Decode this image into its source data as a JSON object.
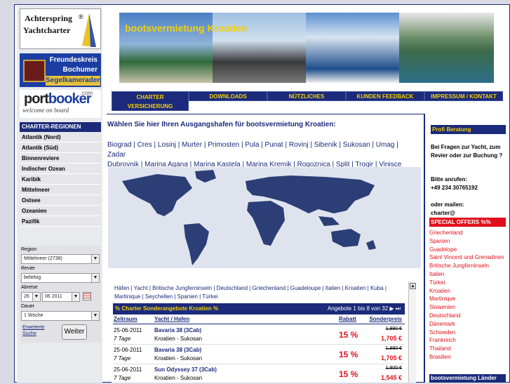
{
  "logos": {
    "achterspring": {
      "line1": "Achterspring",
      "line2": "Yachtcharter",
      "reg": "®"
    },
    "freundeskreis": {
      "line1": "Freundeskreis",
      "line2": "Bochumer",
      "line3": "Segelkameraden"
    },
    "portbooker": {
      "brand_a": "port",
      "brand_b": "booker",
      "domain": ".com",
      "slogan": "welcome on board"
    }
  },
  "regions": {
    "header": "CHARTER-REGIONEN",
    "items": [
      "Atlantik (Nord)",
      "Atlantik (Süd)",
      "Binnenreviere",
      "Indischer Ozean",
      "Karibik",
      "Mittelmeer",
      "Ostsee",
      "Ozeanien",
      "Pazifik"
    ]
  },
  "search": {
    "region_label": "Region",
    "region_value": "Mittelmeer (2738)",
    "revier_label": "Revier",
    "revier_value": "beliebig",
    "abreise_label": "Abreise",
    "day_value": "26",
    "month_value": "06 2011",
    "dauer_label": "Dauer",
    "dauer_value": "1 Woche",
    "extended_1": "Erweiterte",
    "extended_2": "Suche",
    "submit": "Weiter"
  },
  "banner": {
    "title": "bootsvermietung Kroatien"
  },
  "nav": {
    "charter_1": "CHARTER",
    "charter_2": "VERSICHERUNG",
    "downloads": "DOWNLOADS",
    "nuetzliches": "NÜTZLICHES",
    "feedback": "KUNDEN FEEDBACK",
    "impressum": "IMPRESSUM / KONTAKT"
  },
  "main": {
    "heading": "Wählen Sie hier Ihren Ausgangshafen für bootsvermietung Kroatien:",
    "harbors_line1": "Biograd | Cres | Losinj | Murter | Primosten | Pula | Punat | Rovinj | Sibenik | Sukosan | Umag | Zadar",
    "harbors_line2": "Dubrovnik | Marina Agana | Marina Kastela | Marina Kremik | Rogoznica | Split | Trogir | Vinisce"
  },
  "offers": {
    "crumbs_line1": "Häfen | Yacht | Britische Jungferninseln | Deutschland | Griechenland | Guadeloupe | Italien | Kroatien | Kuba |",
    "crumbs_line2": "Martinique | Seychellen | Spanien | Türkei",
    "header": "% Charter Sonderangebote Kroatien %",
    "count": "Angebote 1 bis 8 von 32",
    "col_date": "Zeitraum",
    "col_yacht": "Yacht / Hafen",
    "col_discount": "Rabatt",
    "col_price": "Sonderpreis",
    "rows": [
      {
        "date": "25-06-2011",
        "nights": "7 Tage",
        "yacht": "Bavaria 38 (3Cab)",
        "harbor": "Kroatien - Sukosan",
        "discount": "15 %",
        "old": "1,990 €",
        "new": "1,705 €"
      },
      {
        "date": "25-06-2011",
        "nights": "7 Tage",
        "yacht": "Bavaria 38 (3Cab)",
        "harbor": "Kroatien - Sukosan",
        "discount": "15 %",
        "old": "1,990 €",
        "new": "1,705 €"
      },
      {
        "date": "25-06-2011",
        "nights": "7 Tage",
        "yacht": "Sun Odyssey 37 (3Cab)",
        "harbor": "Kroatien - Sukosan",
        "discount": "15 %",
        "old": "1,800 €",
        "new": "1,545 €"
      }
    ]
  },
  "right": {
    "header": "Profi Beratung",
    "p1": "Bei Fragen zur Yacht, zum Revier oder zur Buchung ?",
    "p2": "Bitte anrufen:",
    "phone": "+49 234 30765192",
    "p3": "oder mailen:",
    "mail": "charter@",
    "special": "SPECIAL OFFERS %%",
    "countries": [
      "Griechenland",
      "Spanien",
      "Guadelope",
      "Saint Vincent und Grenadinen",
      "Britische Jungferninseln",
      "Italien",
      "Türkei",
      "Kroatien",
      "Martinique",
      "Slowenien",
      "Deutschland",
      "Dänemark",
      "Schweden",
      "Frankreich",
      "Thailand",
      "Brasilien"
    ],
    "footer": "bootsvermietung Länder"
  },
  "colors": {
    "navy": "#1b2a7a",
    "yellow": "#f5d000",
    "red": "#e0101a"
  }
}
